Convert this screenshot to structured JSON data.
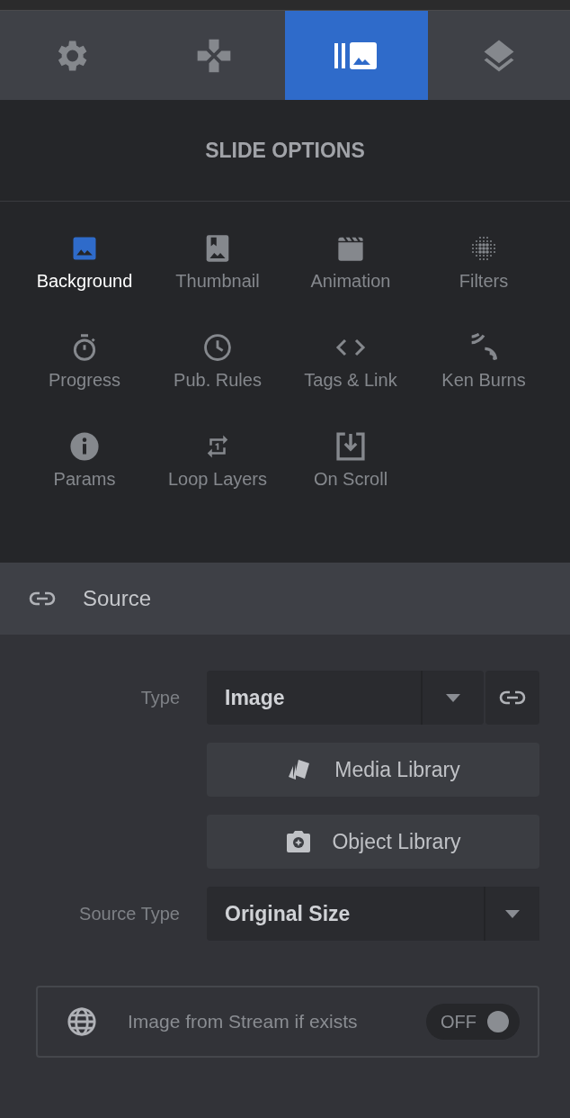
{
  "tabs": [
    {
      "selected": false
    },
    {
      "selected": false
    },
    {
      "selected": true
    },
    {
      "selected": false
    }
  ],
  "panel_title": "SLIDE OPTIONS",
  "options": [
    {
      "label": "Background",
      "selected": true
    },
    {
      "label": "Thumbnail",
      "selected": false
    },
    {
      "label": "Animation",
      "selected": false
    },
    {
      "label": "Filters",
      "selected": false
    },
    {
      "label": "Progress",
      "selected": false
    },
    {
      "label": "Pub. Rules",
      "selected": false
    },
    {
      "label": "Tags & Link",
      "selected": false
    },
    {
      "label": "Ken Burns",
      "selected": false
    },
    {
      "label": "Params",
      "selected": false
    },
    {
      "label": "Loop Layers",
      "selected": false
    },
    {
      "label": "On Scroll",
      "selected": false
    }
  ],
  "section": {
    "title": "Source"
  },
  "type_field": {
    "label": "Type",
    "value": "Image"
  },
  "buttons": [
    "Media Library",
    "Object Library"
  ],
  "source_type_field": {
    "label": "Source Type",
    "value": "Original Size"
  },
  "stream_option": {
    "label": "Image from Stream if exists",
    "toggle_text": "OFF",
    "on": false
  }
}
